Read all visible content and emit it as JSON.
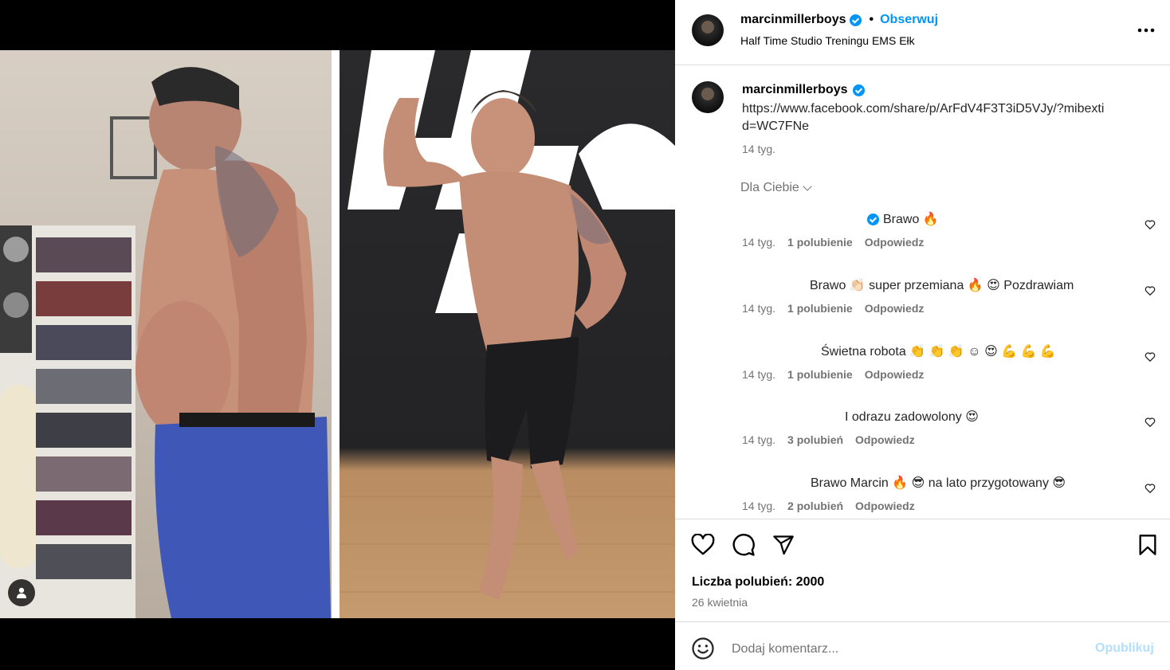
{
  "post": {
    "username": "marcinmillerboys",
    "follow_label": "Obserwuj",
    "location": "Half Time Studio Treningu EMS Ełk",
    "more_icon": "more-horizontal-icon",
    "caption_text": "https://www.facebook.com/share/p/ArFdV4F3T3iD5VJy/?mibextid=WC7FNe",
    "caption_time": "14 tyg.",
    "filter_label": "Dla Ciebie"
  },
  "comments": [
    {
      "text": "Brawo 🔥",
      "verified": true,
      "time": "14 tyg.",
      "likes": "1 polubienie",
      "reply": "Odpowiedz"
    },
    {
      "text": "Brawo 👏🏻 super przemiana 🔥 😍 Pozdrawiam",
      "verified": false,
      "time": "14 tyg.",
      "likes": "1 polubienie",
      "reply": "Odpowiedz"
    },
    {
      "text": "Świetna robota 👏 👏 👏 ☺ 😍 💪 💪 💪",
      "verified": false,
      "time": "14 tyg.",
      "likes": "1 polubienie",
      "reply": "Odpowiedz"
    },
    {
      "text": "I odrazu zadowolony 😍",
      "verified": false,
      "time": "14 tyg.",
      "likes": "3 polubień",
      "reply": "Odpowiedz"
    },
    {
      "text": "Brawo Marcin 🔥 😎 na lato przygotowany 😎",
      "verified": false,
      "time": "14 tyg.",
      "likes": "2 polubień",
      "reply": "Odpowiedz"
    }
  ],
  "actions": {
    "likes_text": "Liczba polubień: 2000",
    "date_text": "26 kwietnia"
  },
  "composer": {
    "placeholder": "Dodaj komentarz...",
    "publish_label": "Opublikuj"
  },
  "colors": {
    "accent": "#0095f6",
    "muted_text": "#737373",
    "border": "#dbdbdb",
    "publish_disabled": "#b2dffc"
  }
}
